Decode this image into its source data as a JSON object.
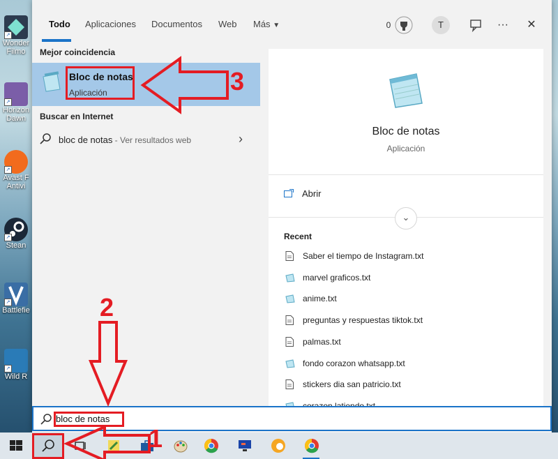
{
  "desktop_icons": [
    {
      "label": "Wonder",
      "label2": "Filmo",
      "color": "#2d3b4f"
    },
    {
      "label": "Horizon",
      "label2": "Dawn",
      "color": "#7b5ea8"
    },
    {
      "label": "Avast F",
      "label2": "Antivi",
      "color": "#f26b1d"
    },
    {
      "label": "Stean",
      "label2": "",
      "color": "#1b2838"
    },
    {
      "label": "Battlefie",
      "label2": "",
      "color": "#3a6ea5"
    },
    {
      "label": "Wild R",
      "label2": "",
      "color": "#2a7bb7"
    }
  ],
  "tabs": [
    {
      "label": "Todo"
    },
    {
      "label": "Aplicaciones"
    },
    {
      "label": "Documentos"
    },
    {
      "label": "Web"
    },
    {
      "label": "Más"
    }
  ],
  "toolbar": {
    "points": "0",
    "avatar_letter": "T",
    "more": "···",
    "close": "✕"
  },
  "best_match": {
    "heading": "Mejor coincidencia",
    "name": "Bloc de notas",
    "type": "Aplicación"
  },
  "web": {
    "heading": "Buscar en Internet",
    "query": "bloc de notas",
    "hint": " - Ver resultados web"
  },
  "preview": {
    "title": "Bloc de notas",
    "subtitle": "Aplicación",
    "open_label": "Abrir",
    "recent_heading": "Recent",
    "recent": [
      {
        "name": "Saber el tiempo de Instagram.txt",
        "kind": "doc"
      },
      {
        "name": "marvel graficos.txt",
        "kind": "note"
      },
      {
        "name": "anime.txt",
        "kind": "note"
      },
      {
        "name": "preguntas y respuestas tiktok.txt",
        "kind": "doc"
      },
      {
        "name": "palmas.txt",
        "kind": "doc"
      },
      {
        "name": "fondo corazon whatsapp.txt",
        "kind": "note"
      },
      {
        "name": "stickers dia san patricio.txt",
        "kind": "doc"
      },
      {
        "name": "corazon latiendo.txt",
        "kind": "note"
      }
    ]
  },
  "search": {
    "value": "bloc de notas"
  },
  "annotations": {
    "n1": "1",
    "n2": "2",
    "n3": "3"
  },
  "colors": {
    "accent": "#1a73c8",
    "selection": "#a4c8e8",
    "annotation": "#e41c23"
  }
}
